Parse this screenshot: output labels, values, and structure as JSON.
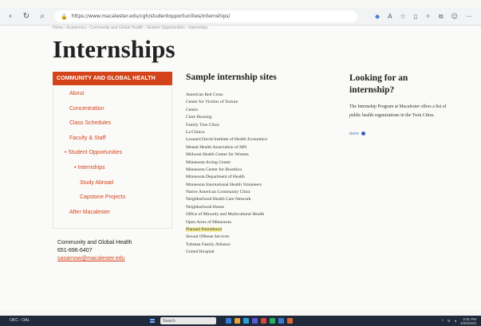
{
  "browser": {
    "url": "https://www.macalester.edu/cgh/studentopportunities/internships/",
    "colors": {
      "accent": "#4a7fd8"
    }
  },
  "page": {
    "title": "Internships",
    "breadcrumbs": "Home  ›  Academics  ›  Community and Global Health  ›  Student Opportunities  ›  Internships"
  },
  "sidebar": {
    "heading": "COMMUNITY AND GLOBAL HEALTH",
    "items": [
      {
        "label": "About"
      },
      {
        "label": "Concentration"
      },
      {
        "label": "Class Schedules"
      },
      {
        "label": "Faculty & Staff"
      },
      {
        "label": "• Student Opportunities"
      },
      {
        "label": "• Internships"
      },
      {
        "label": "Study Abroad"
      },
      {
        "label": "Capstone Projects"
      },
      {
        "label": "After Macalester"
      }
    ],
    "contact": {
      "name": "Community and Global Health",
      "phone": "651-696-6407",
      "email": "sasarnow@macalester.edu"
    },
    "colors": {
      "accent": "#d4441b"
    }
  },
  "sample": {
    "heading": "Sample internship sites",
    "sites": [
      "American Red Cross",
      "Center for Victims of Torture",
      "Centro",
      "Clare Housing",
      "Family Tree Clinic",
      "La Clinica",
      "Leonard David Institute of Health Economics",
      "Mental Health Association of MN",
      "Midwest Health Center for Women",
      "Minnesota Acting Center",
      "Minnesota Center for Bioethics",
      "Minnesota Department of Health",
      "Minnesota International Health Volunteers",
      "Native American Community Clinic",
      "Neighborhood Health Care Network",
      "Neighborhood House",
      "Office of Minority and Multicultural Health",
      "Open Arms of Minnesota",
      "Planned Parenthood",
      "Sexual Offense Services",
      "Tubman Family Alliance",
      "United Hospital"
    ],
    "highlighted": "Planned Parenthood",
    "colors": {
      "highlight": "#f5ef9c"
    }
  },
  "info": {
    "heading": "Looking for an internship?",
    "text": "The Internship Program at Macalester offers a list of public health organizations in the Twin Cities.",
    "more": "more"
  },
  "taskbar": {
    "weather": "OKC - OAL",
    "search": "Search",
    "time": "3:31 PM",
    "date": "4/20/2023"
  }
}
